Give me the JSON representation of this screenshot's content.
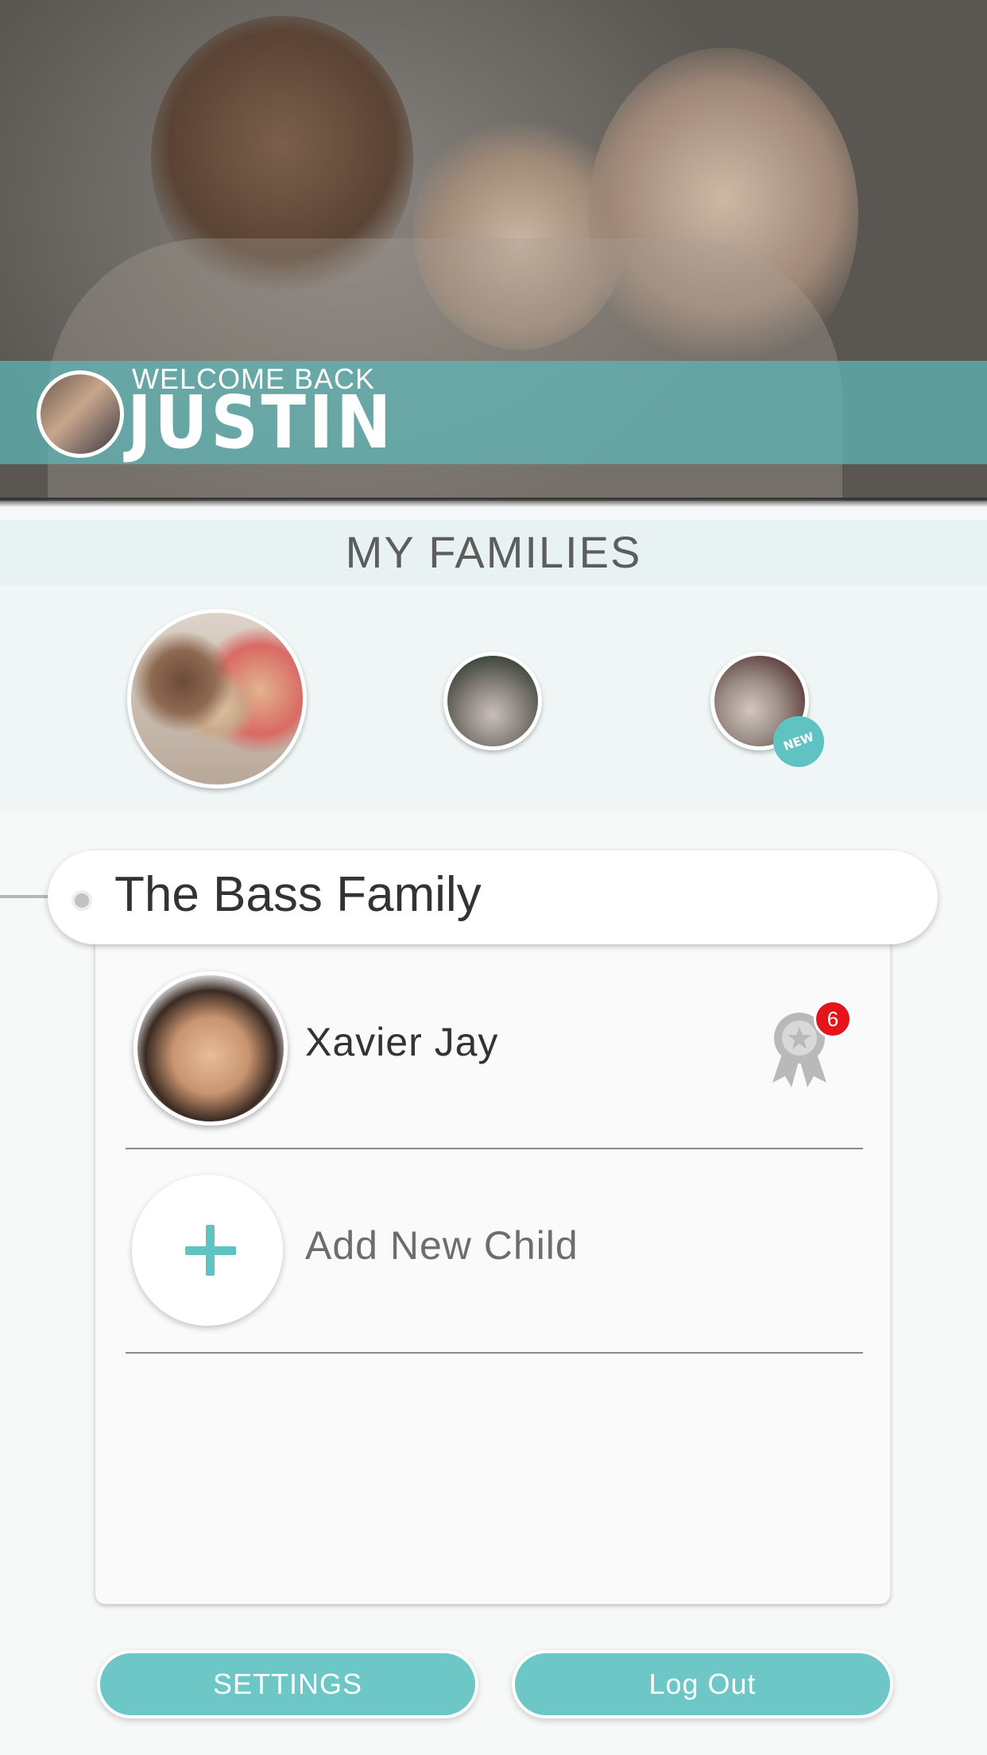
{
  "hero": {
    "welcome_text": "WELCOME BACK",
    "user_name": "JUSTIN"
  },
  "families": {
    "header": "MY FAMILIES",
    "items": [
      {
        "id": "bass",
        "selected": true
      },
      {
        "id": "family-2",
        "selected": false
      },
      {
        "id": "family-3",
        "selected": false,
        "badge": "NEW"
      }
    ]
  },
  "selected_family": {
    "name": "The Bass Family",
    "children": [
      {
        "name": "Xavier Jay",
        "award_count": "6"
      }
    ],
    "add_child_label": "Add New Child"
  },
  "footer": {
    "settings_label": "SETTINGS",
    "logout_label": "Log Out"
  },
  "colors": {
    "accent": "#6cc7c6",
    "badge_red": "#e5141b",
    "header_bg": "#e8f2f3"
  }
}
